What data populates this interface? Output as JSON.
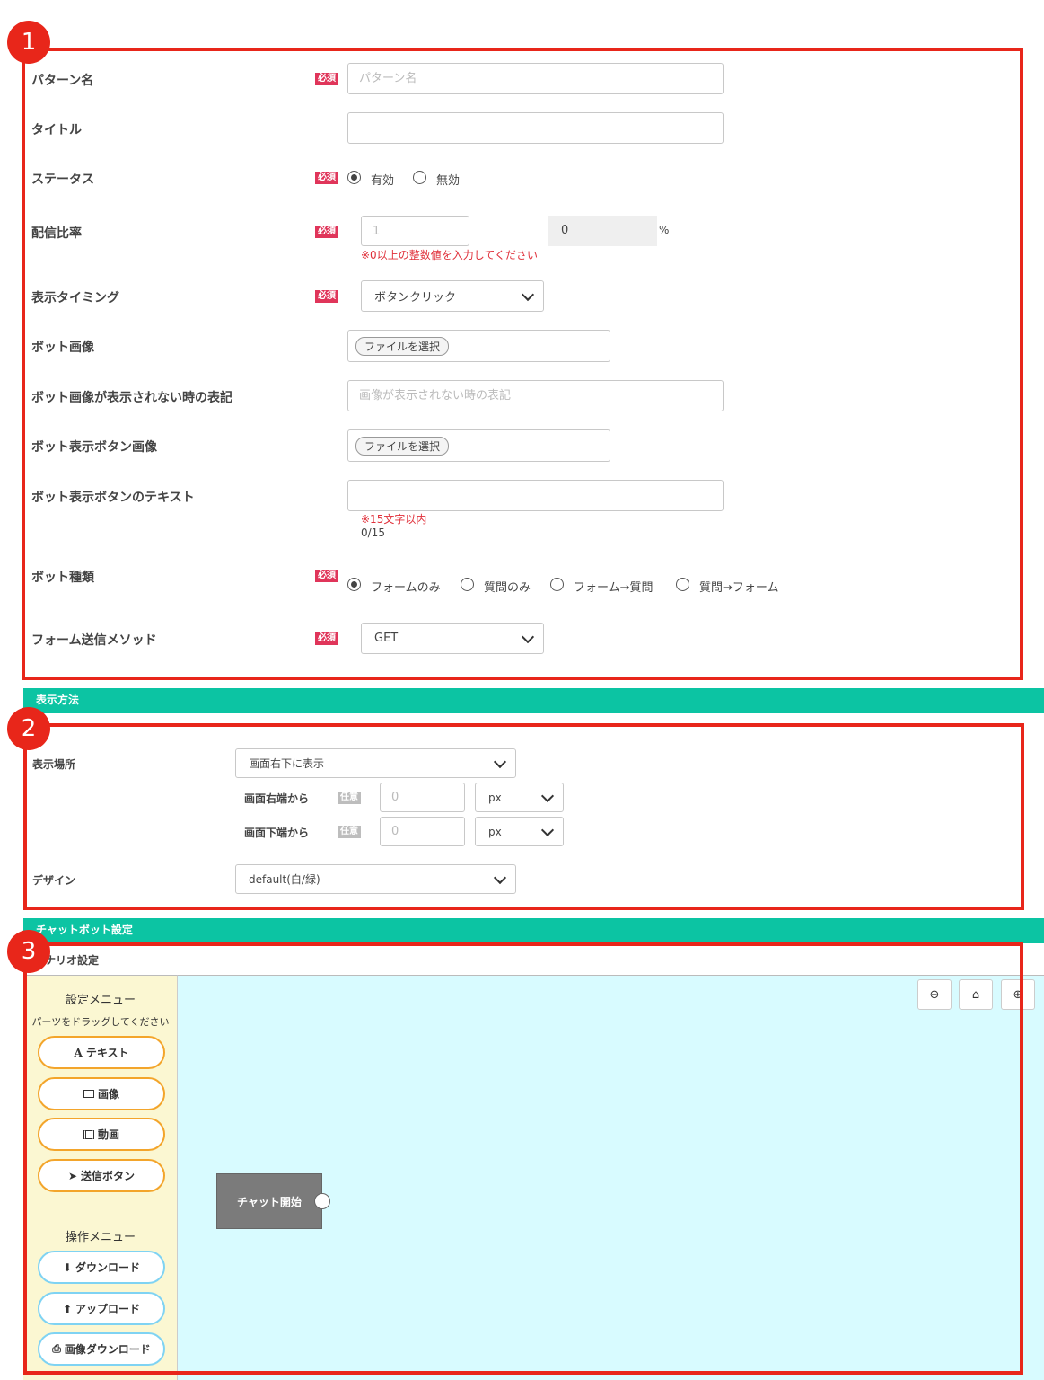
{
  "markers": [
    "1",
    "2",
    "3"
  ],
  "section1": {
    "required_badge": "必須",
    "pattern_name": {
      "label": "パターン名",
      "placeholder": "パターン名"
    },
    "title": {
      "label": "タイトル",
      "value": ""
    },
    "status": {
      "label": "ステータス",
      "options": [
        "有効",
        "無効"
      ],
      "selected": "有効"
    },
    "ratio": {
      "label": "配信比率",
      "placeholder": "1",
      "computed_value": "0",
      "unit": "%",
      "error": "※0以上の整数値を入力してください"
    },
    "timing": {
      "label": "表示タイミング",
      "value": "ボタンクリック"
    },
    "bot_image": {
      "label": "ボット画像",
      "file_button": "ファイルを選択"
    },
    "bot_image_alt": {
      "label": "ボット画像が表示されない時の表記",
      "placeholder": "画像が表示されない時の表記"
    },
    "bot_button_image": {
      "label": "ボット表示ボタン画像",
      "file_button": "ファイルを選択"
    },
    "bot_button_text": {
      "label": "ボット表示ボタンのテキスト",
      "value": "",
      "note": "※15文字以内",
      "counter": "0/15"
    },
    "bot_type": {
      "label": "ボット種類",
      "options": [
        "フォームのみ",
        "質問のみ",
        "フォーム→質問",
        "質問→フォーム"
      ],
      "selected": "フォームのみ"
    },
    "method": {
      "label": "フォーム送信メソッド",
      "value": "GET"
    }
  },
  "display_band": {
    "title": "表示方法"
  },
  "section2": {
    "optional_badge": "任意",
    "location": {
      "label": "表示場所",
      "value": "画面右下に表示"
    },
    "from_right": {
      "label": "画面右端から",
      "placeholder": "0",
      "unit": "px"
    },
    "from_bottom": {
      "label": "画面下端から",
      "placeholder": "0",
      "unit": "px"
    },
    "design": {
      "label": "デザイン",
      "value": "default(白/緑)"
    }
  },
  "chatbot_band": {
    "title": "チャットボット設定"
  },
  "section3": {
    "scenario_label": "シナリオ設定",
    "settings_menu_title": "設定メニュー",
    "drag_hint": "パーツをドラッグしてください",
    "parts": [
      "テキスト",
      "画像",
      "動画",
      "送信ボタン"
    ],
    "ops_menu_title": "操作メニュー",
    "ops": [
      "ダウンロード",
      "アップロード",
      "画像ダウンロード"
    ],
    "start_node": "チャット開始",
    "toolbar_icons": [
      "zoom-out-icon",
      "home-icon",
      "zoom-in-icon"
    ]
  },
  "colors": {
    "red_frame": "#e8261a",
    "band": "#0cc4a3",
    "canvas": "#d8fbff",
    "sidebar": "#fbf7d2",
    "required": "#e0355a"
  }
}
